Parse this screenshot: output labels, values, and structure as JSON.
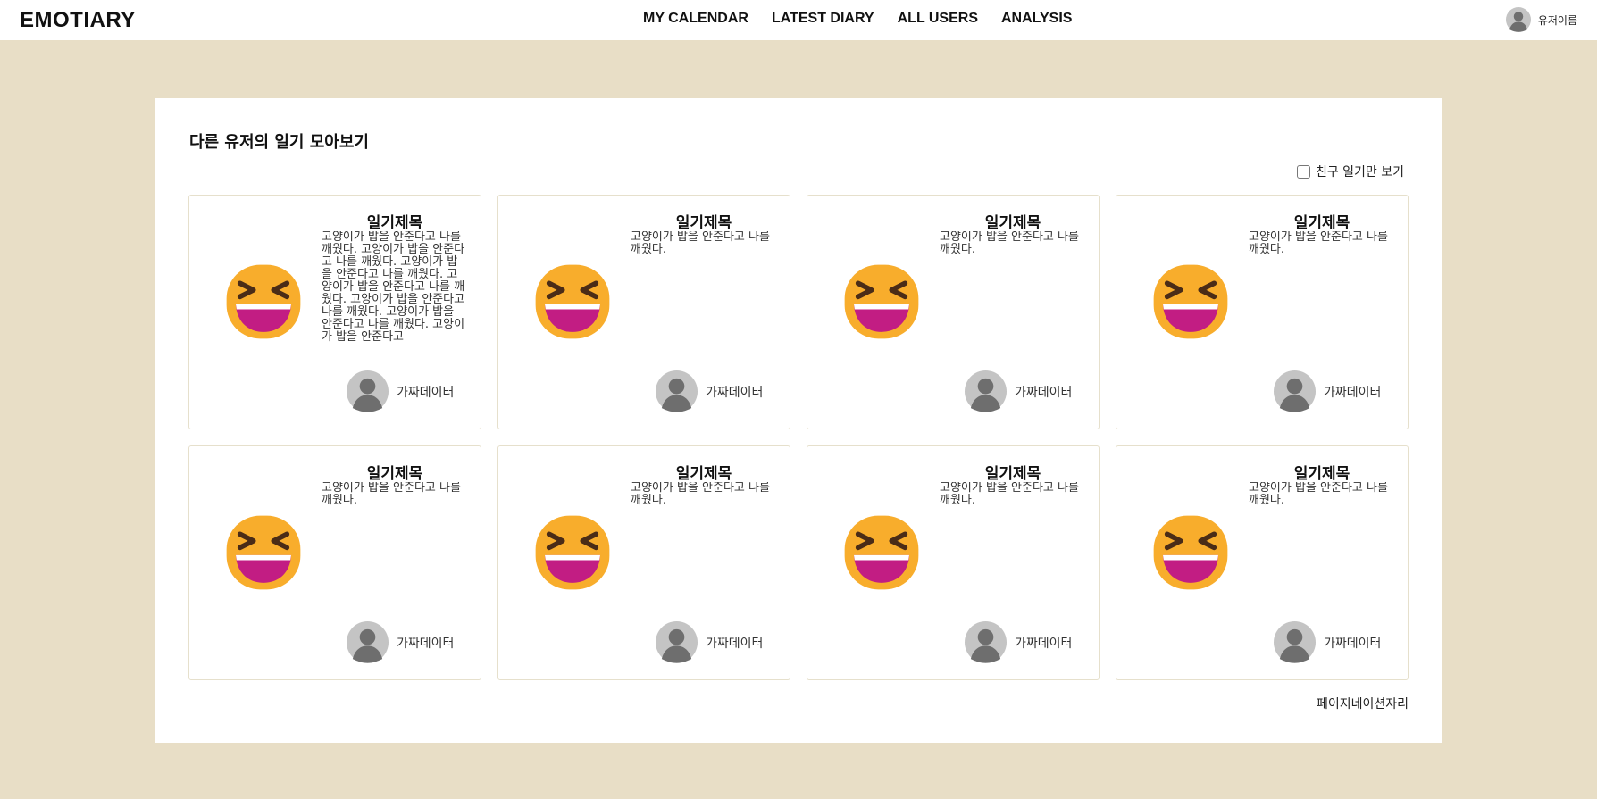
{
  "app": {
    "logo": "EMOTIARY"
  },
  "nav": {
    "items": [
      {
        "label": "MY CALENDAR"
      },
      {
        "label": "LATEST DIARY"
      },
      {
        "label": "ALL USERS"
      },
      {
        "label": "ANALYSIS"
      }
    ]
  },
  "user": {
    "name": "유저이름",
    "avatar_icon": "user-silhouette-icon"
  },
  "page": {
    "title": "다른 유저의 일기 모아보기",
    "filter_label": "친구 일기만 보기",
    "filter_checked": false,
    "pagination": "페이지네이션자리"
  },
  "cards": [
    {
      "title": "일기제목",
      "body": "고양이가 밥을 안준다고 나를 깨웠다. 고양이가 밥을 안준다고 나를 깨웠다. 고양이가 밥을 안준다고 나를 깨웠다. 고양이가 밥을 안준다고 나를 깨웠다. 고양이가 밥을 안준다고 나를 깨웠다. 고양이가 밥을 안준다고 나를 깨웠다. 고양이가 밥을 안준다고",
      "author": "가짜데이터",
      "emoji": "grinning-squinting-face-icon"
    },
    {
      "title": "일기제목",
      "body": "고양이가 밥을 안준다고 나를 깨웠다.",
      "author": "가짜데이터",
      "emoji": "grinning-squinting-face-icon"
    },
    {
      "title": "일기제목",
      "body": "고양이가 밥을 안준다고 나를 깨웠다.",
      "author": "가짜데이터",
      "emoji": "grinning-squinting-face-icon"
    },
    {
      "title": "일기제목",
      "body": "고양이가 밥을 안준다고 나를 깨웠다.",
      "author": "가짜데이터",
      "emoji": "grinning-squinting-face-icon"
    },
    {
      "title": "일기제목",
      "body": "고양이가 밥을 안준다고 나를 깨웠다.",
      "author": "가짜데이터",
      "emoji": "grinning-squinting-face-icon"
    },
    {
      "title": "일기제목",
      "body": "고양이가 밥을 안준다고 나를 깨웠다.",
      "author": "가짜데이터",
      "emoji": "grinning-squinting-face-icon"
    },
    {
      "title": "일기제목",
      "body": "고양이가 밥을 안준다고 나를 깨웠다.",
      "author": "가짜데이터",
      "emoji": "grinning-squinting-face-icon"
    },
    {
      "title": "일기제목",
      "body": "고양이가 밥을 안준다고 나를 깨웠다.",
      "author": "가짜데이터",
      "emoji": "grinning-squinting-face-icon"
    }
  ],
  "colors": {
    "background": "#e8dec6",
    "panel": "#ffffff",
    "emoji_face": "#f8ad2c",
    "emoji_mouth": "#c21d83",
    "avatar": "#c4c4c4"
  }
}
